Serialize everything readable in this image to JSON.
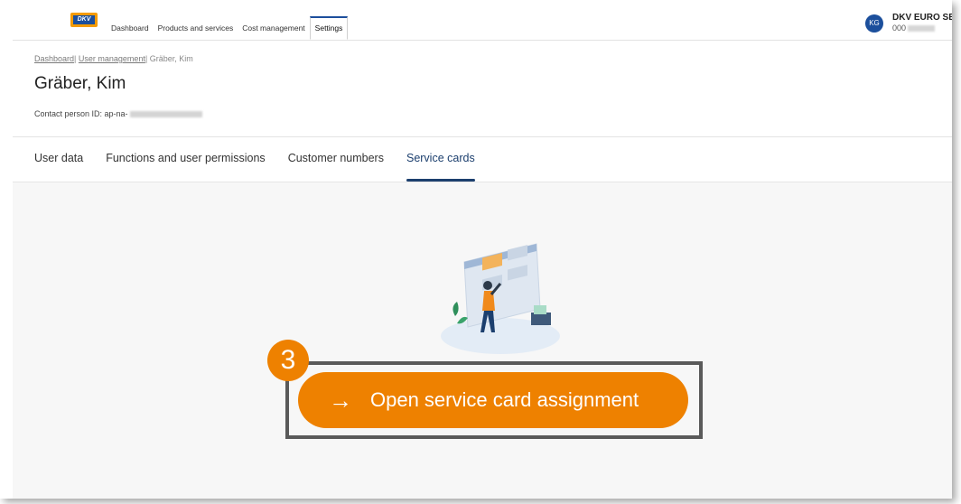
{
  "header": {
    "logo_text": "DKV",
    "nav": [
      {
        "label": "Dashboard",
        "active": false
      },
      {
        "label": "Products and services",
        "active": false
      },
      {
        "label": "Cost management",
        "active": false
      },
      {
        "label": "Settings",
        "active": true
      }
    ],
    "account": {
      "initials": "KG",
      "name": "DKV EURO SER",
      "number": "000"
    }
  },
  "breadcrumb": {
    "items": [
      "Dashboard",
      "User management",
      "Gräber, Kim"
    ]
  },
  "page": {
    "title": "Gräber, Kim",
    "contact_label": "Contact person ID: ap-na-"
  },
  "tabs": [
    {
      "label": "User data",
      "active": false
    },
    {
      "label": "Functions and user permissions",
      "active": false
    },
    {
      "label": "Customer numbers",
      "active": false
    },
    {
      "label": "Service cards",
      "active": true
    }
  ],
  "cta": {
    "arrow": "→",
    "label": "Open service card assignment",
    "step_number": "3"
  },
  "colors": {
    "brand_blue": "#1c4f9c",
    "accent_orange": "#ee8100",
    "highlight_frame": "#5a5a5a"
  }
}
